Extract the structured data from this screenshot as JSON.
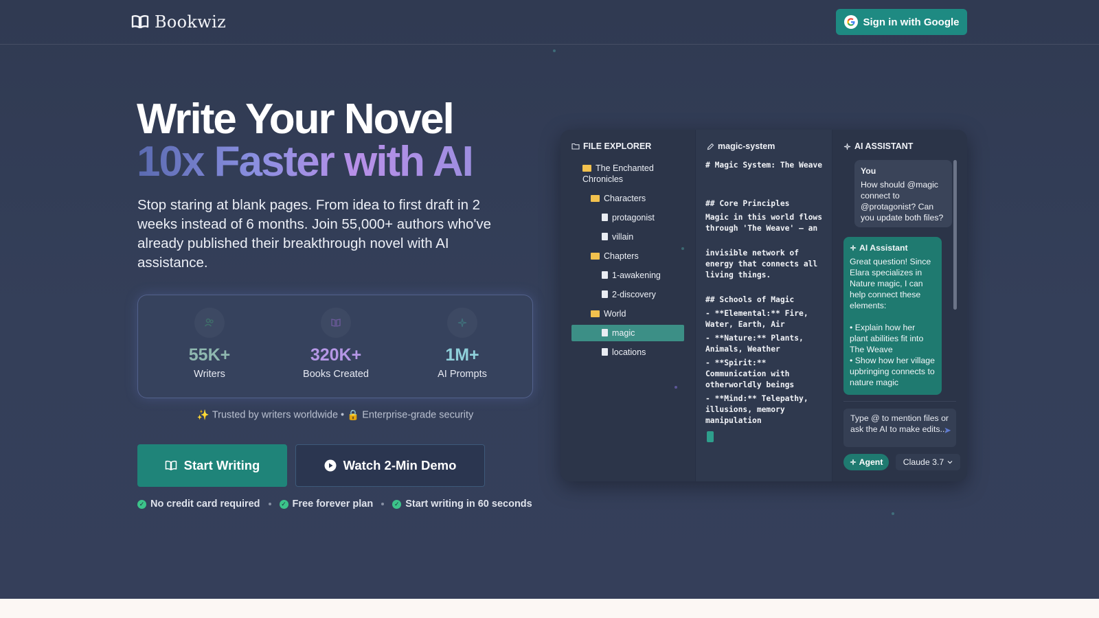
{
  "header": {
    "brand": "Bookwiz",
    "signin_label": "Sign in with Google"
  },
  "hero": {
    "title_line1": "Write Your Novel",
    "title_line2": "10x Faster with AI",
    "subtitle": "Stop staring at blank pages. From idea to first draft in 2 weeks instead of 6 months. Join 55,000+ authors who've already published their breakthrough novel with AI assistance."
  },
  "stats": [
    {
      "value": "55K+",
      "label": "Writers",
      "icon": "users-icon",
      "color": "#8fb8b0"
    },
    {
      "value": "320K+",
      "label": "Books Created",
      "icon": "book-icon",
      "color": "#b597e6"
    },
    {
      "value": "1M+",
      "label": "AI Prompts",
      "icon": "sparkles-icon",
      "color": "#8fd0da"
    }
  ],
  "trust": {
    "item1": "Trusted by writers worldwide",
    "sep": "•",
    "item2": "Enterprise-grade security"
  },
  "cta": {
    "start_label": "Start Writing",
    "demo_label": "Watch 2-Min Demo"
  },
  "perks": [
    "No credit card required",
    "Free forever plan",
    "Start writing in 60 seconds"
  ],
  "app": {
    "explorer_title": "FILE EXPLORER",
    "editor_title": "magic-system",
    "ai_title": "AI ASSISTANT",
    "tree": {
      "root": "The Enchanted Chronicles",
      "characters": "Characters",
      "protagonist": "protagonist",
      "villain": "villain",
      "chapters": "Chapters",
      "ch1": "1-awakening",
      "ch2": "2-discovery",
      "world": "World",
      "magic": "magic",
      "locations": "locations"
    },
    "editor": {
      "h1": "# Magic System: The Weave",
      "h2_core": "## Core Principles",
      "p1": "Magic in this world flows through 'The Weave' – an",
      "p2": "invisible network of energy that connects all living things.",
      "h2_schools": "## Schools of Magic",
      "li1": "- **Elemental:** Fire, Water, Earth, Air",
      "li2": "- **Nature:** Plants, Animals, Weather",
      "li3": "- **Spirit:** Communication with otherworldly beings",
      "li4": "- **Mind:** Telepathy, illusions, memory manipulation"
    },
    "chat": {
      "you_label": "You",
      "you_msg": "How should @magic connect to @protagonist? Can you update both files?",
      "ai_label": "AI Assistant",
      "ai_msg1": "Great question! Since Elara specializes in Nature magic, I can help connect these elements:",
      "ai_msg2": "• Explain how her plant abilities fit into The Weave",
      "ai_msg3": "• Show how her village upbringing connects to nature magic",
      "input_placeholder": "Type @ to mention files or ask the AI to make edits...",
      "agent_label": "Agent",
      "model_label": "Claude 3.7"
    }
  }
}
